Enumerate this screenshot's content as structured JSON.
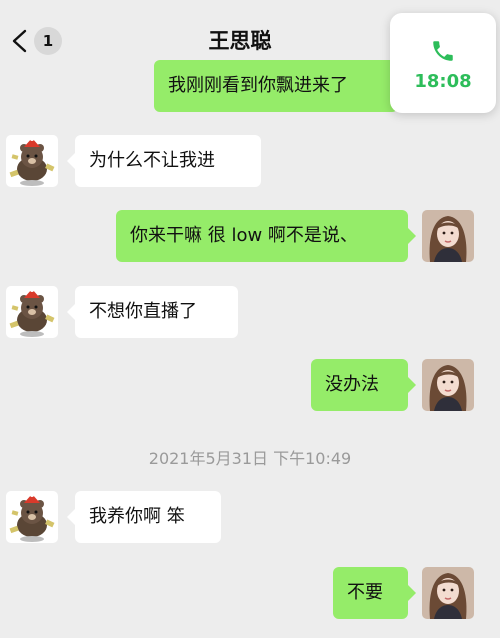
{
  "header": {
    "unread_count": "1",
    "contact_name": "王思聪"
  },
  "call": {
    "duration": "18:08",
    "icon": "phone-icon",
    "color": "#2dbd5a"
  },
  "messages": [
    {
      "direction": "out",
      "text": "我刚刚看到你飘进来了"
    },
    {
      "direction": "in",
      "text": "为什么不让我进"
    },
    {
      "direction": "out",
      "text": "你来干嘛 很 low 啊不是说、"
    },
    {
      "direction": "in",
      "text": "不想你直播了"
    },
    {
      "direction": "out",
      "text": "没办法"
    },
    {
      "direction": "in",
      "text": "我养你啊 笨"
    },
    {
      "direction": "out",
      "text": "不要"
    }
  ],
  "timestamp": "2021年5月31日 下午10:49",
  "colors": {
    "background": "#ededed",
    "outgoing_bubble": "#95ec69",
    "incoming_bubble": "#ffffff"
  }
}
